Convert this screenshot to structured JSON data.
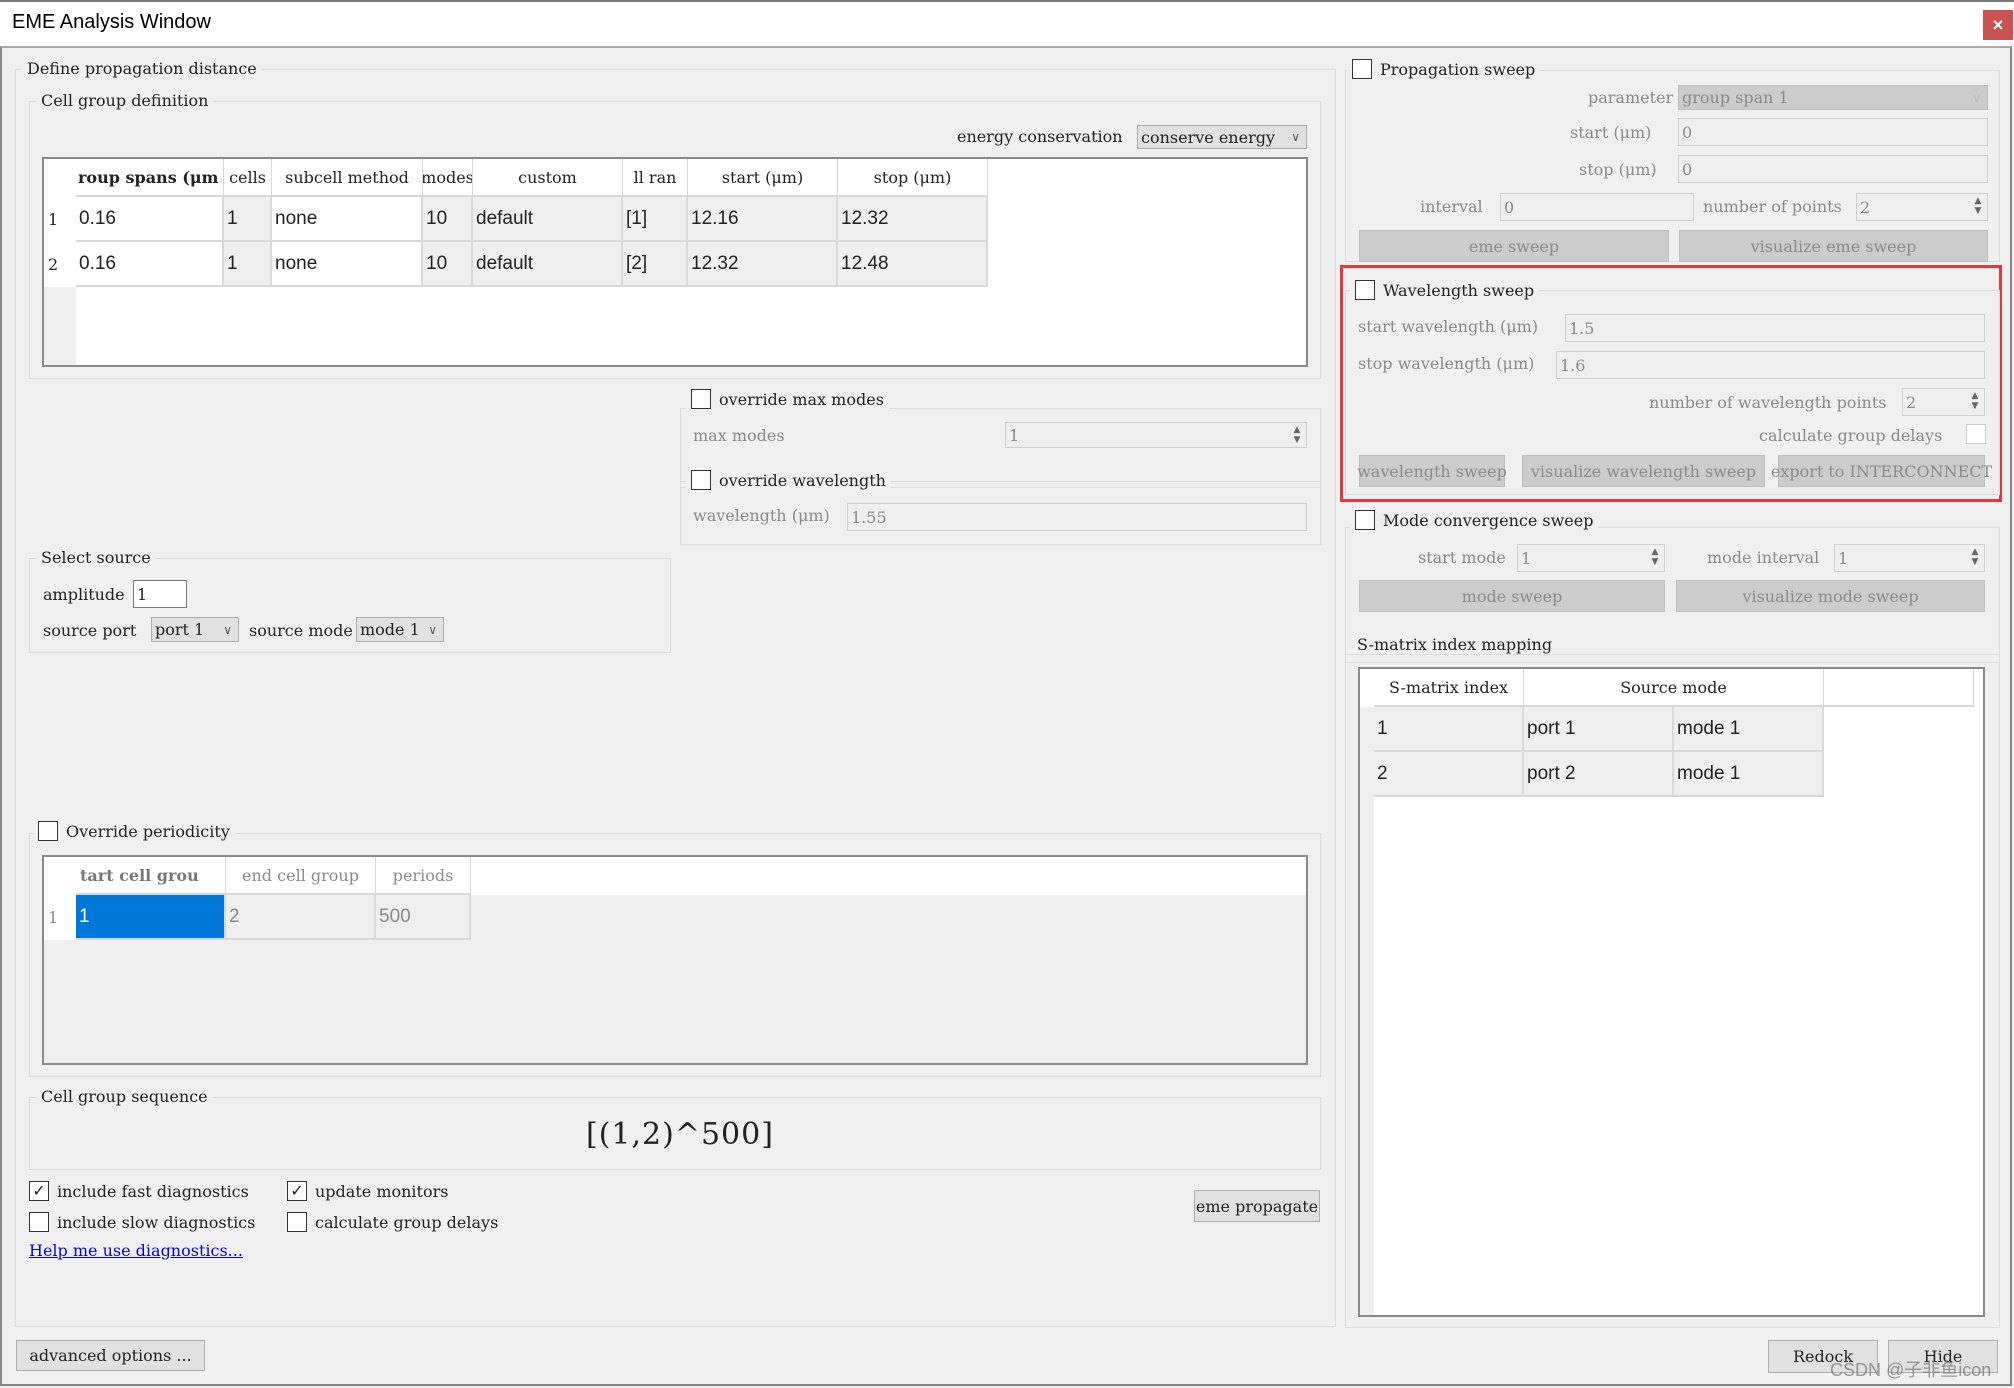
{
  "window": {
    "title": "EME Analysis Window",
    "close_icon": "×"
  },
  "propagation": {
    "group_title": "Define propagation distance",
    "cell_group_def": {
      "title": "Cell group definition",
      "energy_label": "energy conservation",
      "energy_value": "conserve energy",
      "columns": [
        "roup spans (μm",
        "cells",
        "subcell method",
        "modes",
        "custom",
        "ll ran",
        "start (μm)",
        "stop (μm)"
      ],
      "rows": [
        {
          "idx": "1",
          "cells": [
            "0.16",
            "1",
            "none",
            "10",
            "default",
            "[1]",
            "12.16",
            "12.32"
          ]
        },
        {
          "idx": "2",
          "cells": [
            "0.16",
            "1",
            "none",
            "10",
            "default",
            "[2]",
            "12.32",
            "12.48"
          ]
        }
      ]
    },
    "override_max_modes": {
      "label": "override max modes",
      "checked": false,
      "field_label": "max modes",
      "value": "1"
    },
    "override_wavelength": {
      "label": "override wavelength",
      "checked": false,
      "field_label": "wavelength (μm)",
      "value": "1.55"
    },
    "select_source": {
      "title": "Select source",
      "amplitude_label": "amplitude",
      "amplitude": "1",
      "port_label": "source port",
      "port": "port 1",
      "mode_label": "source mode",
      "mode": "mode 1"
    },
    "periodicity": {
      "label": "Override periodicity",
      "checked": false,
      "columns": [
        "tart cell grou",
        "end cell group",
        "periods"
      ],
      "rows": [
        {
          "idx": "1",
          "cells": [
            "1",
            "2",
            "500"
          ]
        }
      ]
    },
    "sequence": {
      "title": "Cell group sequence",
      "value": "[(1,2)^500]"
    },
    "checks": {
      "fast": {
        "label": "include fast diagnostics",
        "checked": true
      },
      "monitors": {
        "label": "update monitors",
        "checked": true
      },
      "slow": {
        "label": "include slow diagnostics",
        "checked": false
      },
      "group_delays": {
        "label": "calculate group delays",
        "checked": false
      }
    },
    "help_link": "Help me use diagnostics...",
    "propagate_button": "eme propagate"
  },
  "propagation_sweep": {
    "label": "Propagation sweep",
    "checked": false,
    "parameter_label": "parameter",
    "parameter": "group span 1",
    "start_label": "start (μm)",
    "start": "0",
    "stop_label": "stop (μm)",
    "stop": "0",
    "interval_label": "interval",
    "interval": "0",
    "points_label": "number of points",
    "points": "2",
    "sweep_button": "eme sweep",
    "visualize_button": "visualize eme sweep"
  },
  "wavelength_sweep": {
    "label": "Wavelength sweep",
    "checked": false,
    "start_label": "start wavelength (μm)",
    "start": "1.5",
    "stop_label": "stop wavelength (μm)",
    "stop": "1.6",
    "points_label": "number of wavelength points",
    "points": "2",
    "group_delays_label": "calculate group delays",
    "sweep_button": "wavelength sweep",
    "visualize_button": "visualize wavelength sweep",
    "export_button": "export to INTERCONNECT",
    "highlight_color": "#e8383d"
  },
  "mode_sweep": {
    "label": "Mode convergence sweep",
    "checked": false,
    "start_label": "start mode",
    "start": "1",
    "interval_label": "mode interval",
    "interval": "1",
    "sweep_button": "mode sweep",
    "visualize_button": "visualize mode sweep"
  },
  "smatrix": {
    "title": "S-matrix index mapping",
    "columns": [
      "S-matrix index",
      "Source mode"
    ],
    "rows": [
      {
        "cells": [
          "1",
          "port 1",
          "mode 1"
        ]
      },
      {
        "cells": [
          "2",
          "port 2",
          "mode 1"
        ]
      }
    ]
  },
  "footer": {
    "advanced": "advanced options ...",
    "redock": "Redock",
    "hide": "Hide",
    "watermark": "CSDN @子非鱼icon"
  },
  "colors": {
    "selection": "#0078d7"
  }
}
